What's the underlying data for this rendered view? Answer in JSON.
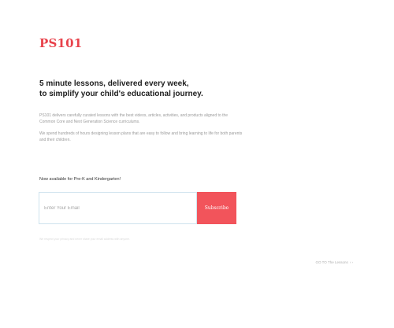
{
  "brand": {
    "logo_text": "PS101",
    "accent_color": "#e8424b"
  },
  "hero": {
    "headline_line1": "5 minute lessons, delivered every week,",
    "headline_line2": "to simplify your child's educational journey.",
    "paragraph1": "PS101 delivers carefully curated lessons with the best videos, articles, activities, and products aligned to the Common Core and Next Generation Science curriculums.",
    "paragraph2": "We spend hundreds of hours designing lesson plans that are easy to follow and bring learning to life for both parents and their children."
  },
  "signup": {
    "availability_text": "Now available for Pre-K and Kindergarten!",
    "email_placeholder": "Enter Your Email",
    "email_value": "",
    "subscribe_label": "Subscribe",
    "button_color": "#f2545b",
    "fineprint": "We respect your privacy and never share your email address with anyone."
  },
  "footer": {
    "goto_label": "GO TO The Lessons",
    "goto_arrow": "› ›"
  }
}
